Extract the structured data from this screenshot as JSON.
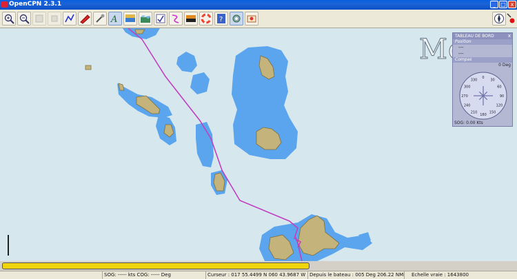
{
  "window": {
    "title": "OpenCPN 2.3.1",
    "min_label": "_",
    "max_label": "□",
    "close_label": "x"
  },
  "toolbar": {
    "buttons": [
      {
        "name": "zoom-in-icon"
      },
      {
        "name": "zoom-out-icon"
      },
      {
        "name": "scale-in-icon"
      },
      {
        "name": "scale-out-icon"
      },
      {
        "name": "route-icon"
      },
      {
        "name": "follow-boat-icon"
      },
      {
        "name": "settings-icon"
      },
      {
        "name": "text-icon"
      },
      {
        "name": "chart-quilt-icon"
      },
      {
        "name": "tides-icon"
      },
      {
        "name": "route-manager-icon"
      },
      {
        "name": "track-icon"
      },
      {
        "name": "color-scheme-icon"
      },
      {
        "name": "mob-icon"
      },
      {
        "name": "help-icon"
      },
      {
        "name": "ais-icon"
      },
      {
        "name": "print-icon"
      }
    ]
  },
  "chart": {
    "place_label": "Mo"
  },
  "dashboard": {
    "title": "TABLEAU DE BORD",
    "close": "x",
    "position_label": "Position",
    "lat": "---",
    "lon": "---",
    "compass_label": "Compas",
    "deg": "0 Deg",
    "sog": "SOG: 0.00 Kts",
    "compass_ticks": [
      "0",
      "30",
      "60",
      "90",
      "120",
      "150",
      "180",
      "210",
      "240",
      "270",
      "300",
      "330"
    ]
  },
  "status": {
    "sog_cog": "SOG: ----- kts  COG: ----- Deg",
    "cursor": "Curseur : 017 55.4499 N 060 43.9687 W",
    "from_boat": "Depuis le bateau : 005 Deg  206.22 NMi",
    "scale": "Echelle vraie :  1643800"
  },
  "colors": {
    "sea": "#d6e8ee",
    "shallow": "#5aa5ee",
    "land": "#c4b47c",
    "route": "#c040c0",
    "progress": "#f0d40e"
  }
}
